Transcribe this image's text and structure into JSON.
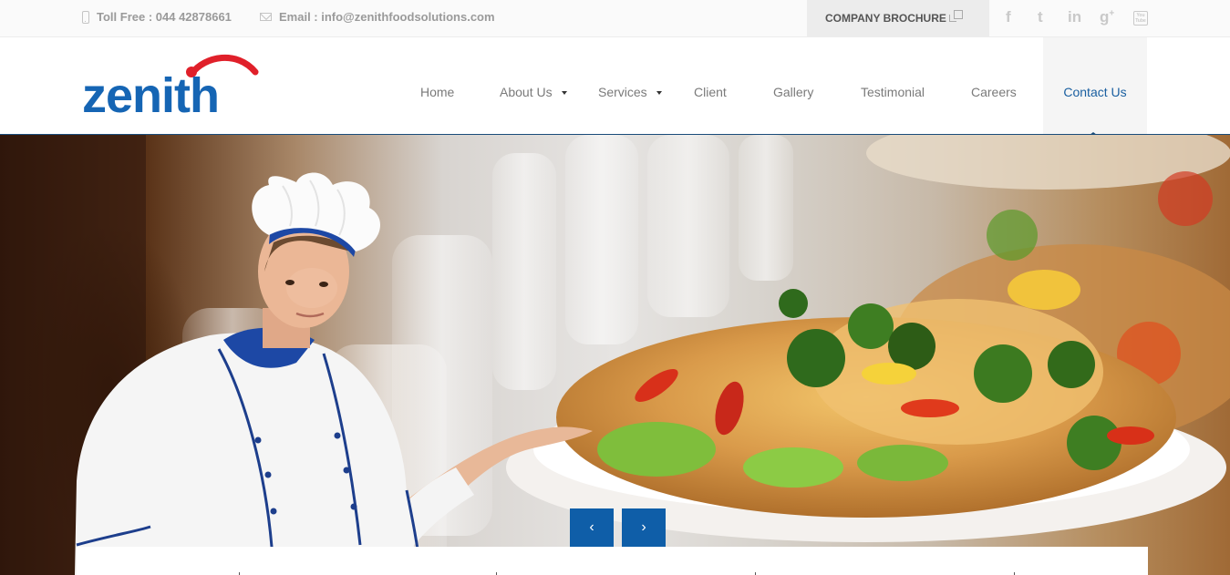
{
  "topbar": {
    "phone_label": "Toll Free : 044 42878661",
    "email_label": "Email : info@zenithfoodsolutions.com",
    "brochure_label": "COMPANY BROCHURE",
    "social_icons": [
      "facebook-icon",
      "twitter-icon",
      "linkedin-icon",
      "google-plus-icon",
      "youtube-icon"
    ],
    "youtube_text": "You Tube"
  },
  "header": {
    "logo_text": "zenith",
    "nav": [
      {
        "label": "Home",
        "dropdown": false
      },
      {
        "label": "About Us",
        "dropdown": true
      },
      {
        "label": "Services",
        "dropdown": true
      },
      {
        "label": "Client",
        "dropdown": false
      },
      {
        "label": "Gallery",
        "dropdown": false
      },
      {
        "label": "Testimonial",
        "dropdown": false
      },
      {
        "label": "Careers",
        "dropdown": false
      },
      {
        "label": "Contact Us",
        "dropdown": false,
        "active": true
      }
    ]
  },
  "slider": {
    "prev_icon": "chevron-left-icon",
    "next_icon": "chevron-right-icon",
    "prev_glyph": "‹",
    "next_glyph": "›"
  },
  "colors": {
    "brand_blue": "#1a5fa0",
    "logo_blue": "#1565b4",
    "logo_red": "#e0202a",
    "slider_button": "#0f5ea8"
  }
}
